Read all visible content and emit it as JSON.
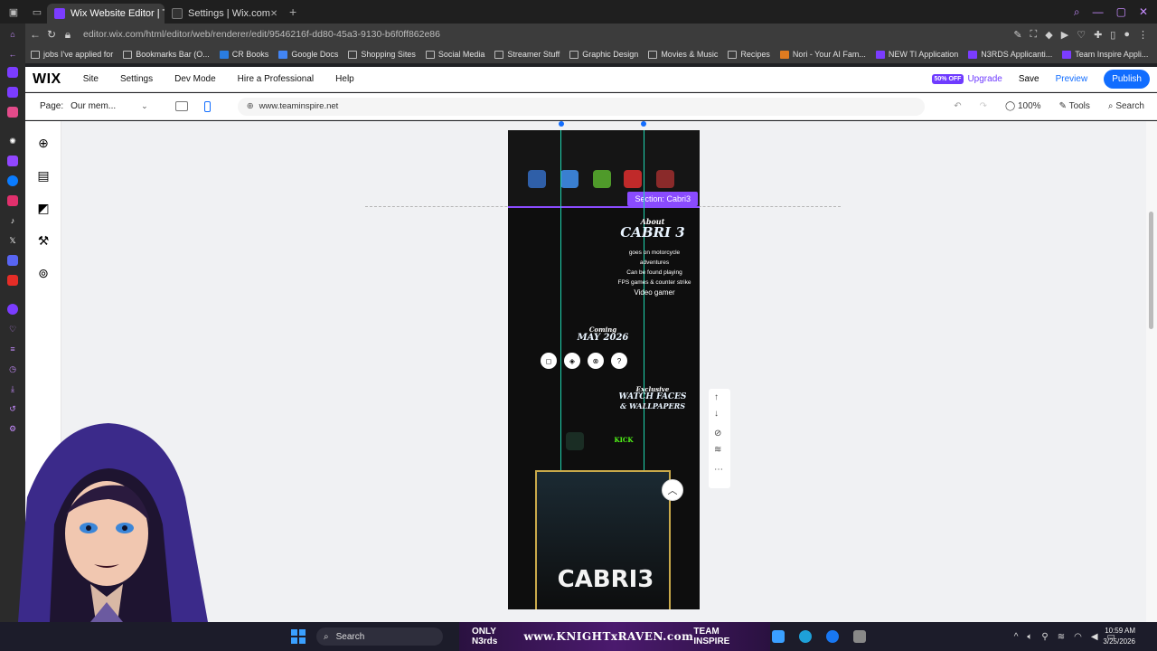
{
  "browser": {
    "tabs": [
      {
        "label": "Wix Website Editor | Team",
        "active": true,
        "favicon_color": "#7b3cff"
      },
      {
        "label": "Settings | Wix.com",
        "active": false,
        "favicon_color": "#333333"
      }
    ],
    "url": "editor.wix.com/html/editor/web/renderer/edit/9546216f-dd80-45a3-9130-b6f0ff862e86",
    "bookmarks": [
      {
        "label": "jobs I've applied for"
      },
      {
        "label": "Bookmarks Bar (O..."
      },
      {
        "label": "CR Books"
      },
      {
        "label": "Google Docs"
      },
      {
        "label": "Shopping Sites"
      },
      {
        "label": "Social Media"
      },
      {
        "label": "Streamer Stuff"
      },
      {
        "label": "Graphic Design"
      },
      {
        "label": "Movies & Music"
      },
      {
        "label": "Recipes"
      },
      {
        "label": "Nori - Your AI Fam..."
      },
      {
        "label": "NEW TI Application"
      },
      {
        "label": "N3RDS Applicanti..."
      },
      {
        "label": "Team Inspire Appli..."
      }
    ]
  },
  "wix": {
    "logo": "WIX",
    "menu": [
      "Site",
      "Settings",
      "Dev Mode",
      "Hire a Professional",
      "Help"
    ],
    "badge": "50% OFF",
    "upgrade": "Upgrade",
    "save": "Save",
    "preview": "Preview",
    "publish": "Publish",
    "page_label": "Page:",
    "page_value": "Our mem...",
    "site_url": "www.teaminspire.net",
    "zoom": "100%",
    "tools": "Tools",
    "search": "Search",
    "accent": "#116dff"
  },
  "site": {
    "section_label": "Section: Cabri3",
    "about_title": "About",
    "about_name": "CABRI 3",
    "about_lines": [
      "goes on motorcycle",
      "adventures",
      "Can be found playing",
      "FPS games & counter strike"
    ],
    "about_role": "Video gamer",
    "coming_top": "Coming",
    "coming_date": "MAY 2026",
    "exclusive_top": "Exclusive",
    "exclusive_line1": "WATCH FACES",
    "exclusive_line2": "& WALLPAPERS",
    "kick": "KICK",
    "card_name": "CABRI3"
  },
  "taskbar": {
    "search": "Search",
    "banner_left": "ONLY N3rds",
    "banner_center": "www.KNIGHTxRAVEN.com",
    "banner_right": "TEAM INSPIRE",
    "time": "10:59 AM",
    "date": "3/25/2026"
  }
}
